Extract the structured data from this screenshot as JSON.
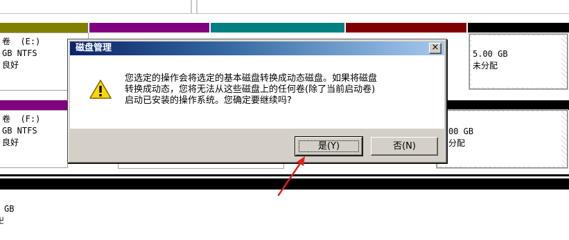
{
  "disk_map": {
    "row1": {
      "partition_e": {
        "name": "卷  (E:)",
        "size": "GB NTFS",
        "status": "良好"
      },
      "unallocated": {
        "size": "5.00 GB",
        "status": "未分配"
      },
      "colors": {
        "olive": "#808000",
        "purple": "#800080",
        "teal": "#008080",
        "maroon": "#800000",
        "black": "#000000"
      }
    },
    "row2": {
      "partition_f": {
        "name": "卷  (F:)",
        "size": "GB NTFS",
        "status": "良好"
      },
      "unallocated": {
        "size": "00 GB",
        "status": "分配"
      }
    },
    "row3": {
      "size": "GB",
      "status": "卍"
    }
  },
  "dialog": {
    "title": "磁盘管理",
    "close_label": "×",
    "icon": "warning-icon",
    "message_lines": [
      "您选定的操作会将选定的基本磁盘转换成动态磁盘。如果将磁盘",
      "转换成动态，您将无法从这些磁盘上的任何卷(除了当前启动卷)",
      "启动已安装的操作系统。您确定要继续吗?"
    ],
    "yes_label": "是(Y)",
    "no_label": "否(N)"
  },
  "annotation": {
    "arrow_color": "#e02020"
  }
}
